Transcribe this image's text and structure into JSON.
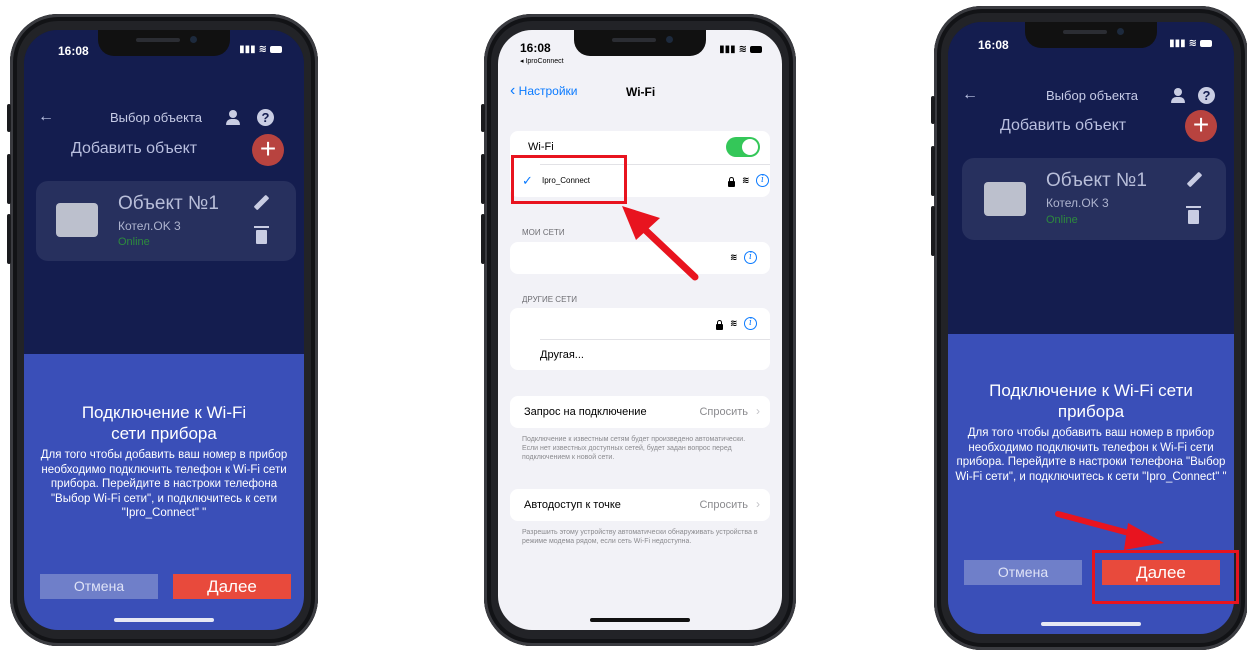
{
  "colors": {
    "app_bg": "#141d4f",
    "sheet_bg": "#3a4fb8",
    "next_button": "#e84a3c",
    "cancel_button": "#6f7fc9",
    "ios_bg": "#f2f2f7",
    "ios_accent": "#0a7aff",
    "toggle_on": "#34c759",
    "highlight": "#e8141f"
  },
  "phone_left": {
    "time": "16:08",
    "header": {
      "title": "Выбор объекта",
      "back_icon": "back-arrow-icon",
      "user_icon": "user-icon",
      "help_icon": "help-icon",
      "help_glyph": "?"
    },
    "add_object_label": "Добавить объект",
    "add_button_glyph": "+",
    "object": {
      "name": "Объект №1",
      "model": "Котел.OK 3",
      "status": "Online"
    },
    "dialog": {
      "title": "Подключение к Wi-Fi сети прибора",
      "text": "Для того чтобы добавить ваш номер в прибор необходимо подключить телефон к Wi-Fi сети прибора. Перейдите в настроки телефона \"Выбор Wi-Fi сети\", и подключитесь к сети \"Ipro_Connect\"  \"",
      "cancel_label": "Отмена",
      "next_label": "Далее"
    }
  },
  "phone_middle": {
    "time": "16:08",
    "back_app": "◂ IproConnect",
    "nav": {
      "back_label": "Настройки",
      "title": "Wi-Fi"
    },
    "wifi_label": "Wi-Fi",
    "wifi_enabled": true,
    "connected_network": "Ipro_Connect",
    "my_networks_header": "МОИ СЕТИ",
    "other_networks_header": "ДРУГИЕ СЕТИ",
    "other_label": "Другая...",
    "ask_join": {
      "label": "Запрос на подключение",
      "value": "Спросить",
      "note": "Подключение к известным сетям будет произведено автоматически. Если нет известных доступных сетей, будет задан вопрос перед подключением к новой сети."
    },
    "auto_hotspot": {
      "label": "Автодоступ к точке",
      "value": "Спросить",
      "note": "Разрешить этому устройству автоматически обнаруживать устройства в режиме модема рядом, если сеть Wi-Fi недоступна."
    }
  },
  "phone_right": {
    "time": "16:08",
    "header": {
      "title": "Выбор объекта",
      "back_icon": "back-arrow-icon",
      "user_icon": "user-icon",
      "help_icon": "help-icon",
      "help_glyph": "?"
    },
    "add_object_label": "Добавить объект",
    "add_button_glyph": "+",
    "object": {
      "name": "Объект №1",
      "model": "Котел.OK 3",
      "status": "Online"
    },
    "dialog": {
      "title": "Подключение к Wi-Fi сети прибора",
      "text": "Для того чтобы добавить ваш номер в прибор необходимо подключить телефон к Wi-Fi сети прибора. Перейдите в настроки телефона \"Выбор Wi-Fi сети\", и подключитесь к сети \"Ipro_Connect\"  \"",
      "cancel_label": "Отмена",
      "next_label": "Далее"
    }
  }
}
